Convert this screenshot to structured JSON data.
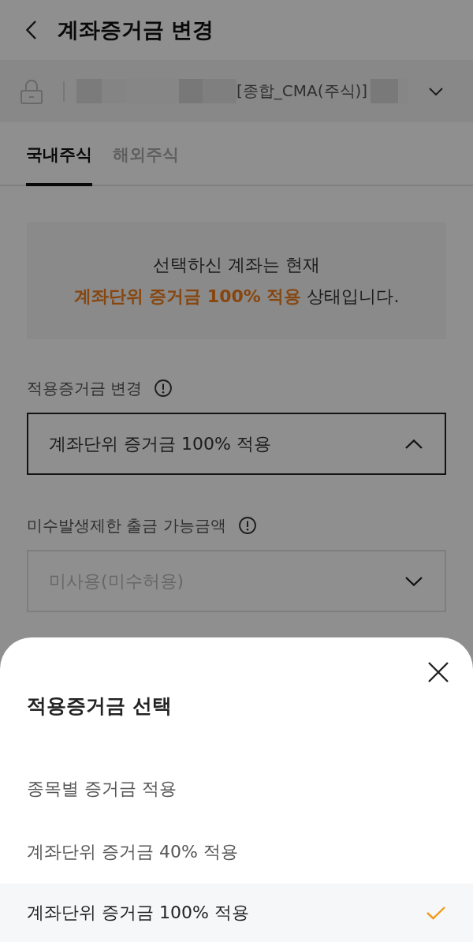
{
  "header": {
    "title": "계좌증거금 변경"
  },
  "account": {
    "name": "[종합_CMA(주식)]"
  },
  "tabs": [
    {
      "label": "국내주식",
      "selected": true
    },
    {
      "label": "해외주식",
      "selected": false
    }
  ],
  "notice": {
    "lines": [
      "선택하신 계좌는 현재",
      "**계좌단위 증거금 100% 적용** 상태입니다."
    ]
  },
  "fields": [
    {
      "label": "적용증거금 변경",
      "value": "계좌단위 증거금 100% 적용",
      "expanded": true,
      "disabled": false
    },
    {
      "label": "미수발생제한 출금 가능금액",
      "value": "미사용(미수허용)",
      "expanded": false,
      "disabled": true
    }
  ],
  "sheet": {
    "title": "적용증거금 선택",
    "options": [
      {
        "label": "종목별 증거금 적용",
        "selected": false
      },
      {
        "label": "계좌단위 증거금 40% 적용",
        "selected": false
      },
      {
        "label": "계좌단위 증거금 100% 적용",
        "selected": true
      }
    ]
  }
}
